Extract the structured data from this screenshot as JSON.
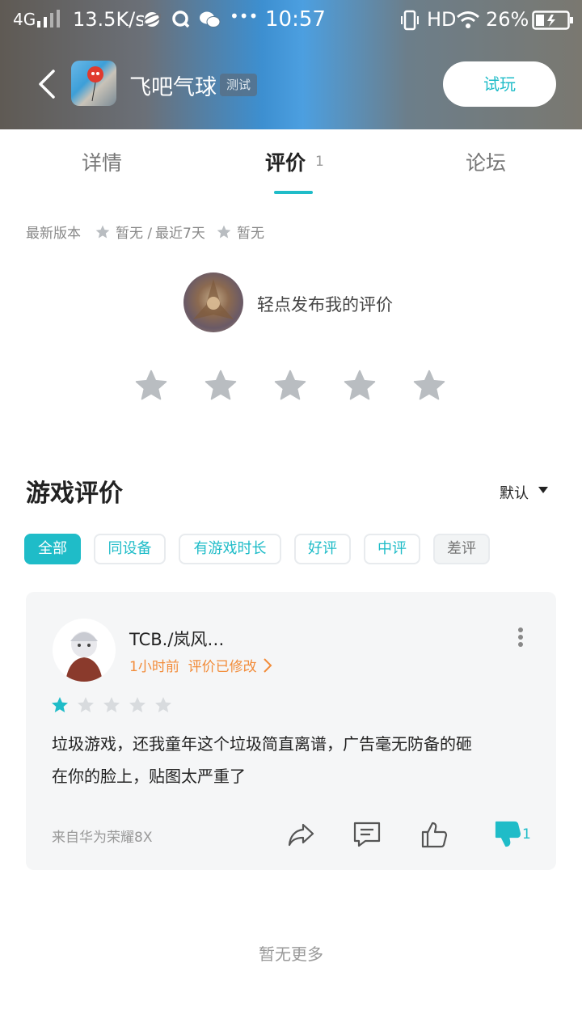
{
  "status_bar": {
    "network": "4G",
    "speed": "13.5K/s",
    "more": "•••",
    "time": "10:57",
    "hd": "HD",
    "battery": "26%"
  },
  "header": {
    "app_title": "飞吧气球",
    "badge": "测试",
    "try_button": "试玩"
  },
  "tabs": {
    "details": "详情",
    "reviews": "评价",
    "reviews_count": "1",
    "forum": "论坛"
  },
  "version_info": {
    "latest_label": "最新版本",
    "latest_value": "暂无 /",
    "recent_label": "最近7天",
    "recent_value": "暂无"
  },
  "compose": {
    "prompt": "轻点发布我的评价"
  },
  "reviews_section": {
    "title": "游戏评价",
    "sort": "默认",
    "filters": [
      "全部",
      "同设备",
      "有游戏时长",
      "好评",
      "中评",
      "差评"
    ]
  },
  "review": {
    "username": "TCB./岚风…",
    "time": "1小时前",
    "edited": "评价已修改",
    "rating": 1,
    "rating_max": 5,
    "text_line1": "垃圾游戏，还我童年这个垃圾简直离谱，广告毫无防备的砸",
    "text_line2": "在你的脸上，贴图太严重了",
    "device": "来自华为荣耀8X",
    "dislike_count": "1"
  },
  "footer": {
    "no_more": "暂无更多"
  },
  "colors": {
    "accent": "#1fbcc8",
    "orange": "#f28c3a",
    "star_empty": "#b9bdc1"
  }
}
